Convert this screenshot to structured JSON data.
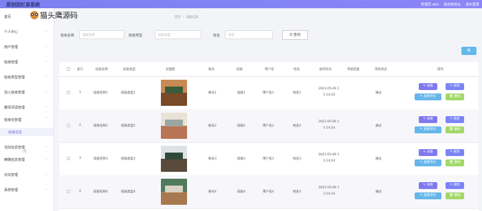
{
  "app": {
    "title": "原创回忆录系统"
  },
  "header": {
    "links": [
      "管理员 abo",
      "退出到前台",
      "退出登录"
    ]
  },
  "watermark": {
    "text": "猫头鹰源码"
  },
  "sidebar": {
    "items": [
      {
        "label": "首页"
      },
      {
        "label": "个人中心"
      },
      {
        "label": "用户管理"
      },
      {
        "label": "班级管理"
      },
      {
        "label": "班级类型管理"
      },
      {
        "label": "加入班级管理"
      },
      {
        "label": "教师须请管理"
      },
      {
        "label": "班级信管理"
      },
      {
        "label": "班级信息"
      },
      {
        "label": "活动信息管理"
      },
      {
        "label": "精确信息管理"
      },
      {
        "label": "论坛管理"
      },
      {
        "label": "系统管理"
      }
    ]
  },
  "breadcrumb": {
    "home": "首页",
    "current": "班级信息"
  },
  "search": {
    "label1": "班级名称",
    "placeholder1": "班级名称",
    "label2": "班级类型",
    "placeholder2": "班级类型",
    "label3": "班名",
    "placeholder3": "班名",
    "button": "Q 查询"
  },
  "toolbar": {
    "add_label": "新"
  },
  "table": {
    "headers": [
      "索引",
      "班级名称",
      "班级类型",
      "封面图",
      "账号",
      "班级",
      "用户名",
      "姓名",
      "发布时间",
      "审核回复",
      "审核状态",
      "操作"
    ],
    "rows": [
      {
        "index": "1",
        "name": "班级名称1",
        "type": "班级类型1",
        "account": "账号1",
        "cls": "班级1",
        "user": "用户名1",
        "real": "姓名1",
        "time1": "2021-05-09 1",
        "time2": "1:14:24",
        "reply": "",
        "status": "通过"
      },
      {
        "index": "2",
        "name": "班级名称2",
        "type": "班级类型2",
        "account": "账号2",
        "cls": "班级2",
        "user": "用户名2",
        "real": "姓名2",
        "time1": "2021-05-09 1",
        "time2": "1:14:24",
        "reply": "",
        "status": "通过"
      },
      {
        "index": "3",
        "name": "班级名称3",
        "type": "班级类型3",
        "account": "账号3",
        "cls": "班级3",
        "user": "用户名3",
        "real": "姓名3",
        "time1": "2021-05-09 1",
        "time2": "1:14:24",
        "reply": "",
        "status": "通过"
      },
      {
        "index": "4",
        "name": "班级名称4",
        "type": "班级类型4",
        "account": "账号4",
        "cls": "班级4",
        "user": "用户名4",
        "real": "姓名4",
        "time1": "2021-05-09 1",
        "time2": "1:14:24",
        "reply": "",
        "status": "通过"
      }
    ],
    "actions": {
      "detail": "✎ 详情",
      "edit": "✎ 修改",
      "comment": "✎ 查看评论",
      "delete": "🗑 删除"
    }
  },
  "colors": {
    "topbar": "#7c80f0",
    "detail": "#7f78ee",
    "comment": "#67b6ea",
    "delete": "#a3d86a",
    "add": "#63b9ec"
  }
}
